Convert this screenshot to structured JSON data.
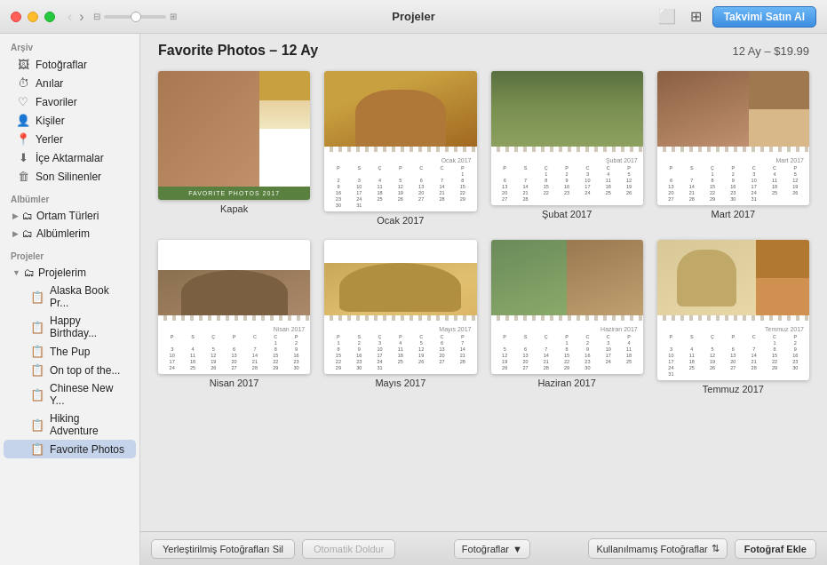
{
  "titlebar": {
    "title": "Projeler",
    "buy_label": "Takvimi Satın Al"
  },
  "sidebar": {
    "archive_label": "Arşiv",
    "archive_items": [
      {
        "id": "fotograflar",
        "icon": "🖼",
        "label": "Fotoğraflar"
      },
      {
        "id": "anilar",
        "icon": "⏱",
        "label": "Anılar"
      },
      {
        "id": "favoriler",
        "icon": "♡",
        "label": "Favoriler"
      },
      {
        "id": "kisiler",
        "icon": "👤",
        "label": "Kişiler"
      },
      {
        "id": "yerler",
        "icon": "📍",
        "label": "Yerler"
      },
      {
        "id": "ice-aktarmalar",
        "icon": "⬇",
        "label": "İçe Aktarmalar"
      },
      {
        "id": "son-silinenler",
        "icon": "🗑",
        "label": "Son Silinenler"
      }
    ],
    "albums_label": "Albümler",
    "album_items": [
      {
        "id": "ortam-turleri",
        "label": "Ortam Türleri",
        "hasArrow": true
      },
      {
        "id": "albumlerim",
        "label": "Albümlerim",
        "hasArrow": true
      }
    ],
    "projects_label": "Projeler",
    "project_items": [
      {
        "id": "projelerim",
        "label": "Projelerim",
        "hasArrow": true,
        "isGroup": true
      },
      {
        "id": "alaska",
        "label": "Alaska Book Pr...",
        "isChild": true
      },
      {
        "id": "happy-birthday",
        "label": "Happy Birthday...",
        "isChild": true
      },
      {
        "id": "the-pup",
        "label": "The Pup",
        "isChild": true
      },
      {
        "id": "on-top-of",
        "label": "On top of the...",
        "isChild": true
      },
      {
        "id": "chinese-new",
        "label": "Chinese New Y...",
        "isChild": true
      },
      {
        "id": "hiking",
        "label": "Hiking Adventure",
        "isChild": true
      },
      {
        "id": "favorite-photos",
        "label": "Favorite Photos",
        "isChild": true,
        "active": true
      }
    ]
  },
  "content": {
    "title": "Favorite Photos – 12 Ay",
    "price": "12 Ay – $19.99",
    "calendars": [
      {
        "id": "cover",
        "label": "Kapak",
        "type": "cover"
      },
      {
        "id": "ocak",
        "label": "Ocak 2017",
        "type": "month",
        "month": "Ocak 2017"
      },
      {
        "id": "subat",
        "label": "Şubat 2017",
        "type": "month",
        "month": "Şubat 2017"
      },
      {
        "id": "mart",
        "label": "Mart 2017",
        "type": "month",
        "month": "Mart 2017"
      },
      {
        "id": "nisan",
        "label": "Nisan 2017",
        "type": "month2",
        "month": "Nisan 2017"
      },
      {
        "id": "mayis",
        "label": "Mayıs 2017",
        "type": "month2",
        "month": "Mayıs 2017"
      },
      {
        "id": "haziran",
        "label": "Haziran 2017",
        "type": "month2",
        "month": "Haziran 2017"
      },
      {
        "id": "temmuz",
        "label": "Temmuz 2017",
        "type": "month2",
        "month": "Temmuz 2017"
      }
    ]
  },
  "toolbar": {
    "delete_label": "Yerleştirilmiş Fotoğrafları Sil",
    "auto_fill_label": "Otomatik Doldur",
    "photos_label": "Fotoğraflar",
    "unused_label": "Kullanılmamış Fotoğraflar",
    "add_photo_label": "Fotoğraf Ekle"
  }
}
